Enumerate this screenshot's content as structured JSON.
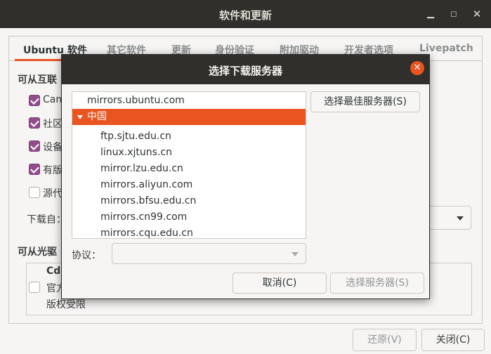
{
  "main_window": {
    "title": "软件和更新",
    "tabs": [
      "Ubuntu 软件",
      "其它软件",
      "更新",
      "身份验证",
      "附加驱动",
      "开发者选项",
      "Livepatch"
    ],
    "section_internet": "可从互联",
    "checkboxes": [
      {
        "label": "Can",
        "checked": true
      },
      {
        "label": "社区",
        "checked": true
      },
      {
        "label": "设备",
        "checked": true
      },
      {
        "label": "有版",
        "checked": true
      },
      {
        "label": "源代",
        "checked": false
      }
    ],
    "download_from_label": "下载自：",
    "section_cdrom": "可从光驱",
    "cdrom_title": "Cdr",
    "cdrom_line1": "官方",
    "cdrom_line2": "版权受限",
    "revert_button": "还原(V)",
    "close_button": "关闭(C)"
  },
  "dialog": {
    "title": "选择下载服务器",
    "mirrors": [
      {
        "label": "mirrors.ubuntu.com",
        "level": 0,
        "selected": false
      },
      {
        "label": "中国",
        "level": 0,
        "selected": true,
        "expanded": true
      },
      {
        "label": "ftp.sjtu.edu.cn",
        "level": 1,
        "selected": false
      },
      {
        "label": "linux.xjtuns.cn",
        "level": 1,
        "selected": false
      },
      {
        "label": "mirror.lzu.edu.cn",
        "level": 1,
        "selected": false
      },
      {
        "label": "mirrors.aliyun.com",
        "level": 1,
        "selected": false
      },
      {
        "label": "mirrors.bfsu.edu.cn",
        "level": 1,
        "selected": false
      },
      {
        "label": "mirrors.cn99.com",
        "level": 1,
        "selected": false
      },
      {
        "label": "mirrors.cqu.edu.cn",
        "level": 1,
        "selected": false
      }
    ],
    "best_server_button": "选择最佳服务器(S)",
    "protocol_label": "协议：",
    "protocol_value": "",
    "cancel_button": "取消(C)",
    "choose_server_button": "选择服务器(S)"
  }
}
